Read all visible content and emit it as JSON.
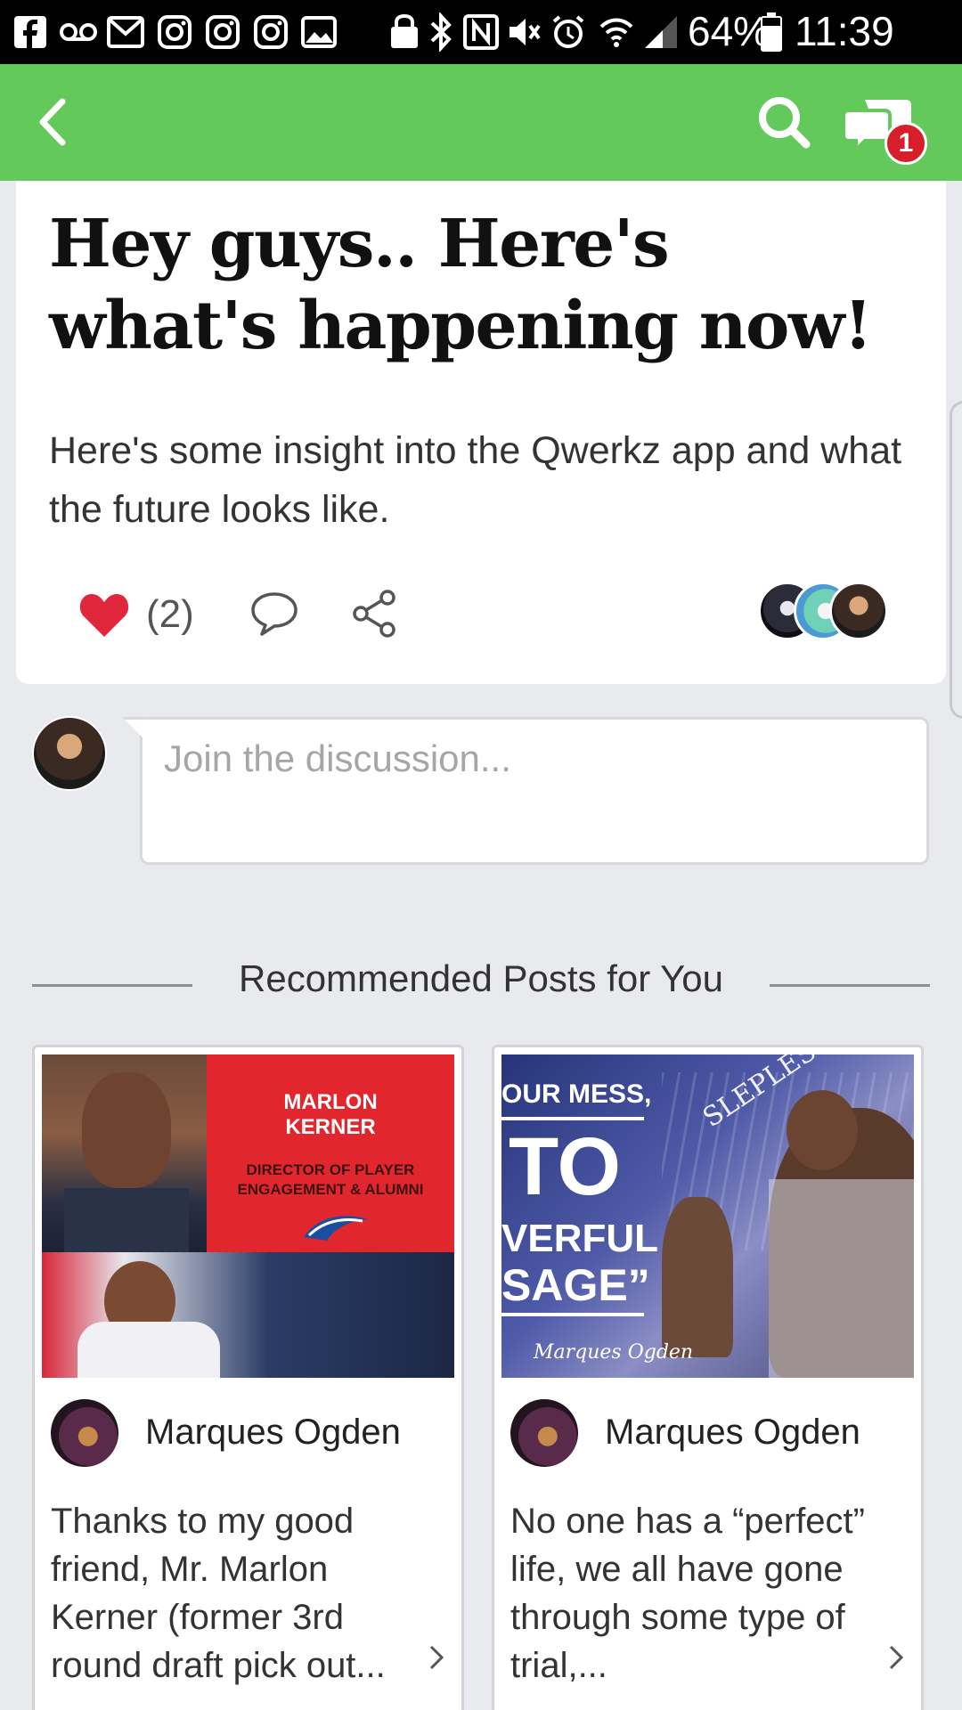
{
  "status_bar": {
    "battery": "64%",
    "time": "11:39 AM"
  },
  "app_bar": {
    "notification_count": "1",
    "accent_color": "#63c95a",
    "badge_color": "#d71f2b"
  },
  "post": {
    "title": "Hey guys.. Here's what's happening now!",
    "description": "Here's some insight into the Qwerkz app and what the future looks like.",
    "like_count": "(2)",
    "heart_color": "#e0263b"
  },
  "comment": {
    "placeholder": "Join the discussion..."
  },
  "recommended": {
    "heading": "Recommended Posts for You",
    "cards": [
      {
        "image_text": {
          "name_line1": "MARLON",
          "name_line2": "KERNER",
          "role_line1": "DIRECTOR OF PLAYER",
          "role_line2": "ENGAGEMENT & ALUMNI"
        },
        "author": "Marques Ogden",
        "excerpt": "Thanks to my good friend, Mr. Marlon Kerner (former 3rd round draft pick out..."
      },
      {
        "image_text": {
          "line1": "OUR MESS,",
          "line2": "TO",
          "line3": "VERFUL",
          "line4": "SAGE”",
          "line5": "SLEPLESS NIGHTS",
          "signature": "Marques Ogden"
        },
        "author": "Marques Ogden",
        "excerpt": "No one has a “perfect” life, we all have gone through some type of trial,..."
      }
    ]
  }
}
